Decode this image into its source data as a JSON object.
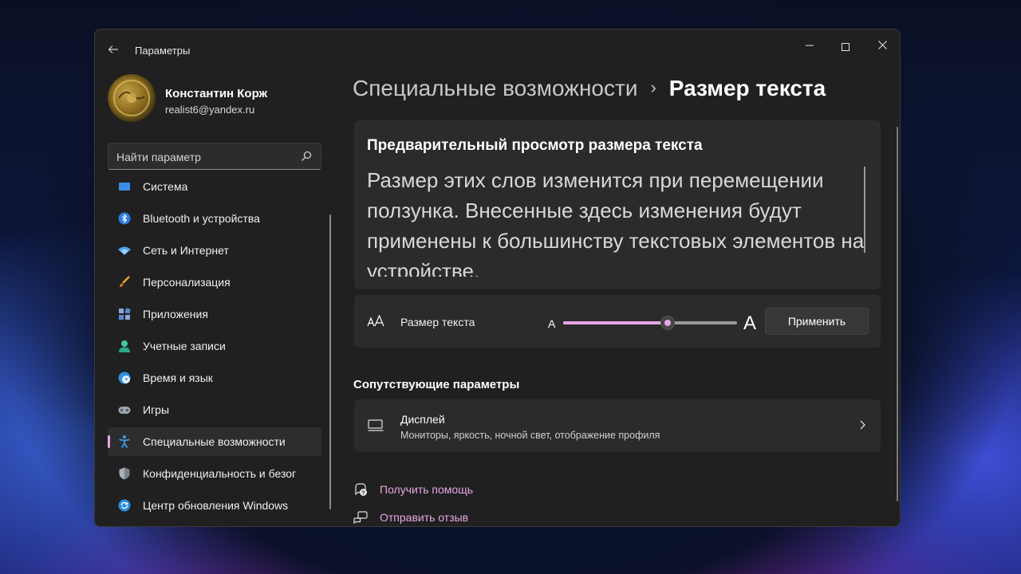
{
  "window": {
    "app_title": "Параметры",
    "controls": {
      "minimize": "—",
      "close": "✕"
    }
  },
  "profile": {
    "name": "Константин Корж",
    "email": "realist6@yandex.ru"
  },
  "search": {
    "placeholder": "Найти параметр",
    "icon": "search-icon"
  },
  "sidebar": {
    "items": [
      {
        "label": "Система",
        "icon": "system-icon"
      },
      {
        "label": "Bluetooth и устройства",
        "icon": "bluetooth-icon"
      },
      {
        "label": "Сеть и Интернет",
        "icon": "wifi-icon"
      },
      {
        "label": "Персонализация",
        "icon": "brush-icon"
      },
      {
        "label": "Приложения",
        "icon": "apps-icon"
      },
      {
        "label": "Учетные записи",
        "icon": "account-icon"
      },
      {
        "label": "Время и язык",
        "icon": "globe-clock-icon"
      },
      {
        "label": "Игры",
        "icon": "gamepad-icon"
      },
      {
        "label": "Специальные возможности",
        "icon": "accessibility-icon",
        "active": true
      },
      {
        "label": "Конфиденциальность и безог",
        "icon": "shield-icon"
      },
      {
        "label": "Центр обновления Windows",
        "icon": "update-icon"
      }
    ]
  },
  "breadcrumb": {
    "parent": "Специальные возможности",
    "separator": "›",
    "current": "Размер текста"
  },
  "preview": {
    "title": "Предварительный просмотр размера текста",
    "text": "Размер этих слов изменится при перемещении ползунка. Внесенные здесь изменения будут применены к большинству текстовых элементов на устройстве."
  },
  "text_size": {
    "icon": "text-size-icon",
    "icon_glyph": "A͏A",
    "label": "Размер текста",
    "slider_min_label": "A",
    "slider_max_label": "A",
    "slider_value_fraction": 0.6,
    "apply_label": "Применить"
  },
  "related": {
    "heading": "Сопутствующие параметры",
    "display": {
      "title": "Дисплей",
      "subtitle": "Мониторы, яркость, ночной свет, отображение профиля",
      "icon": "monitor-icon"
    }
  },
  "links": {
    "help": "Получить помощь",
    "feedback": "Отправить отзыв"
  },
  "colors": {
    "accent": "#e8a6e6",
    "window_bg": "#202020",
    "card_bg": "#2b2b2b"
  }
}
